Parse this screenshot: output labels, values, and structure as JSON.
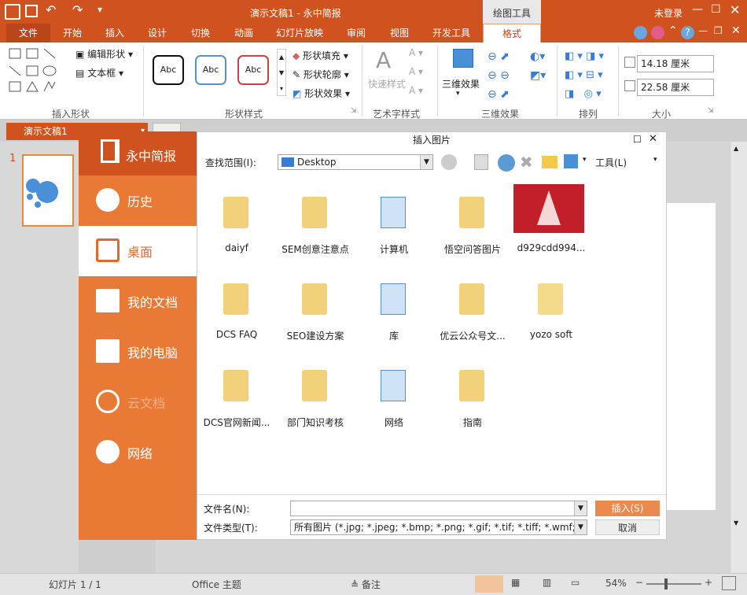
{
  "app": {
    "title": "演示文稿1 - 永中简报",
    "context_tab": "绘图工具",
    "login": "未登录"
  },
  "tabs": [
    "文件",
    "开始",
    "插入",
    "设计",
    "切换",
    "动画",
    "幻灯片放映",
    "审阅",
    "视图",
    "开发工具",
    "格式"
  ],
  "ribbon": {
    "insert_shape": {
      "label": "插入形状",
      "edit_shape": "编辑形状",
      "textbox": "文本框"
    },
    "shape_style": {
      "label": "形状样式",
      "presets": [
        "Abc",
        "Abc",
        "Abc"
      ],
      "fill": "形状填充",
      "outline": "形状轮廓",
      "effect": "形状效果"
    },
    "art_text": {
      "label": "艺术字样式",
      "quick": "快速样式"
    },
    "threed": {
      "label": "三维效果",
      "button": "三维效果"
    },
    "arrange": {
      "label": "排列"
    },
    "size": {
      "label": "大小",
      "height": "14.18 厘米",
      "width": "22.58 厘米"
    }
  },
  "doc_tab": "演示文稿1",
  "slide_number": "1",
  "dialog": {
    "title": "插入图片",
    "brand": "永中简报",
    "side": [
      {
        "label": "历史",
        "icon": "clock-icon"
      },
      {
        "label": "桌面",
        "icon": "desktop-icon"
      },
      {
        "label": "我的文档",
        "icon": "documents-icon"
      },
      {
        "label": "我的电脑",
        "icon": "computer-icon"
      },
      {
        "label": "云文档",
        "icon": "cloud-icon"
      },
      {
        "label": "网络",
        "icon": "network-icon"
      }
    ],
    "lookin_label": "查找范围(I):",
    "lookin_value": "Desktop",
    "tools_label": "工具(L)",
    "items": [
      {
        "name": "daiyf",
        "icon": "user-folder-icon"
      },
      {
        "name": "SEM创意注意点",
        "icon": "user-folder-icon"
      },
      {
        "name": "计算机",
        "icon": "computer-icon"
      },
      {
        "name": "悟空问答图片",
        "icon": "user-folder-icon"
      },
      {
        "name": "d929cdd994...",
        "icon": "image-thumbnail"
      },
      {
        "name": "DCS FAQ",
        "icon": "user-folder-icon"
      },
      {
        "name": "SEO建设方案",
        "icon": "user-folder-icon"
      },
      {
        "name": "库",
        "icon": "library-icon"
      },
      {
        "name": "优云公众号文...",
        "icon": "user-folder-icon"
      },
      {
        "name": "yozo soft",
        "icon": "folder-icon"
      },
      {
        "name": "DCS官网新闻...",
        "icon": "user-folder-icon"
      },
      {
        "name": "部门知识考核",
        "icon": "user-folder-icon"
      },
      {
        "name": "网络",
        "icon": "network-icon"
      },
      {
        "name": "指南",
        "icon": "user-folder-icon"
      }
    ],
    "filename_label": "文件名(N):",
    "filename_value": "",
    "filetype_label": "文件类型(T):",
    "filetype_value": "所有图片 (*.jpg; *.jpeg; *.bmp; *.png; *.gif; *.tif; *.tiff; *.wmf; *....",
    "insert_btn": "插入(S)",
    "cancel_btn": "取消"
  },
  "status": {
    "slide": "幻灯片 1 / 1",
    "theme": "Office 主题",
    "notes": "备注",
    "zoom": "54%"
  },
  "colors": {
    "accent": "#d0531f",
    "side": "#e87a36",
    "insert_btn": "#ec8a4e"
  }
}
